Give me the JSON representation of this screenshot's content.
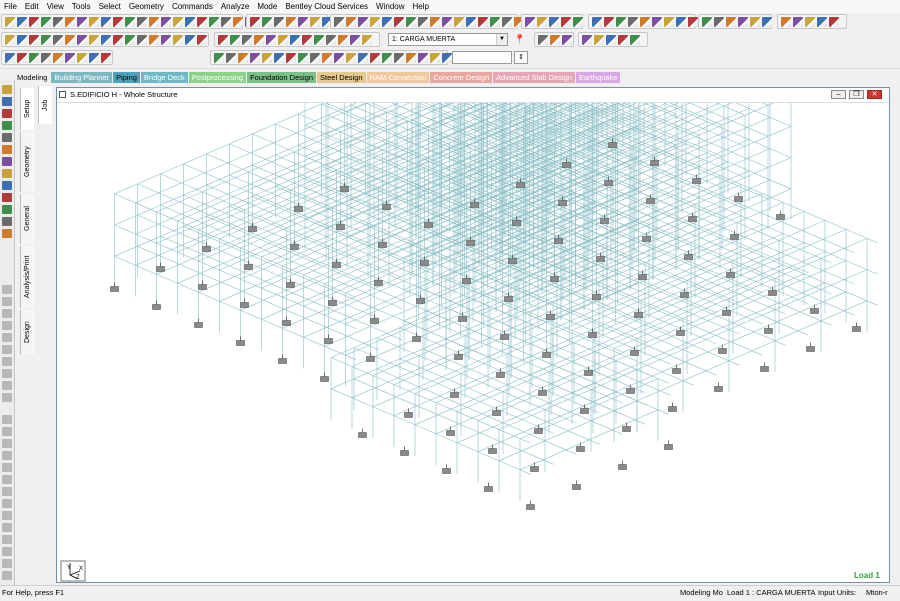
{
  "menu": [
    "File",
    "Edit",
    "View",
    "Tools",
    "Select",
    "Geometry",
    "Commands",
    "Analyze",
    "Mode",
    "Bentley Cloud Services",
    "Window",
    "Help"
  ],
  "toolbar": {
    "load_case_value": "1: CARGA MUERTA"
  },
  "workflow_tabs": [
    {
      "label": "Modeling",
      "bg": "#f0f0f0",
      "fg": "#000000"
    },
    {
      "label": "Building Planner",
      "bg": "#7fb7c0",
      "fg": "#ffffff"
    },
    {
      "label": "Piping",
      "bg": "#4aa3b8",
      "fg": "#000000"
    },
    {
      "label": "Bridge Deck",
      "bg": "#6fb8c6",
      "fg": "#ffffff"
    },
    {
      "label": "Postprocessing",
      "bg": "#8ed18a",
      "fg": "#ffffff"
    },
    {
      "label": "Foundation Design",
      "bg": "#7cbf88",
      "fg": "#000000"
    },
    {
      "label": "Steel Design",
      "bg": "#e6c890",
      "fg": "#000000"
    },
    {
      "label": "RAM Connection",
      "bg": "#f0c8a0",
      "fg": "#ffffff"
    },
    {
      "label": "Concrete Design",
      "bg": "#e8a7a0",
      "fg": "#ffffff"
    },
    {
      "label": "Advanced Slab Design",
      "bg": "#e5a6b6",
      "fg": "#ffffff"
    },
    {
      "label": "Earthquake",
      "bg": "#d6a9e4",
      "fg": "#ffffff"
    }
  ],
  "side_tabs": {
    "job": "Job",
    "setup": "Setup",
    "geometry": "Geometry",
    "general": "General",
    "analysis_print": "Analysis/Print",
    "design": "Design"
  },
  "window": {
    "title": "S.EDIFICIO H - Whole Structure"
  },
  "view": {
    "load_label": "Load 1",
    "axis_y": "Y",
    "axis_x": "X",
    "axis_z": "Z"
  },
  "status": {
    "help": "For Help, press F1",
    "mode": "Modeling Mo",
    "load": "Load 1 : CARGA MUERTA",
    "units_label": "Input Units:",
    "units": "Mton-r"
  },
  "colors": {
    "frame": "#8cc0c6",
    "frame_dark": "#6aa5ad",
    "support": "#8a8a8a",
    "load_label": "#2fa63a"
  }
}
